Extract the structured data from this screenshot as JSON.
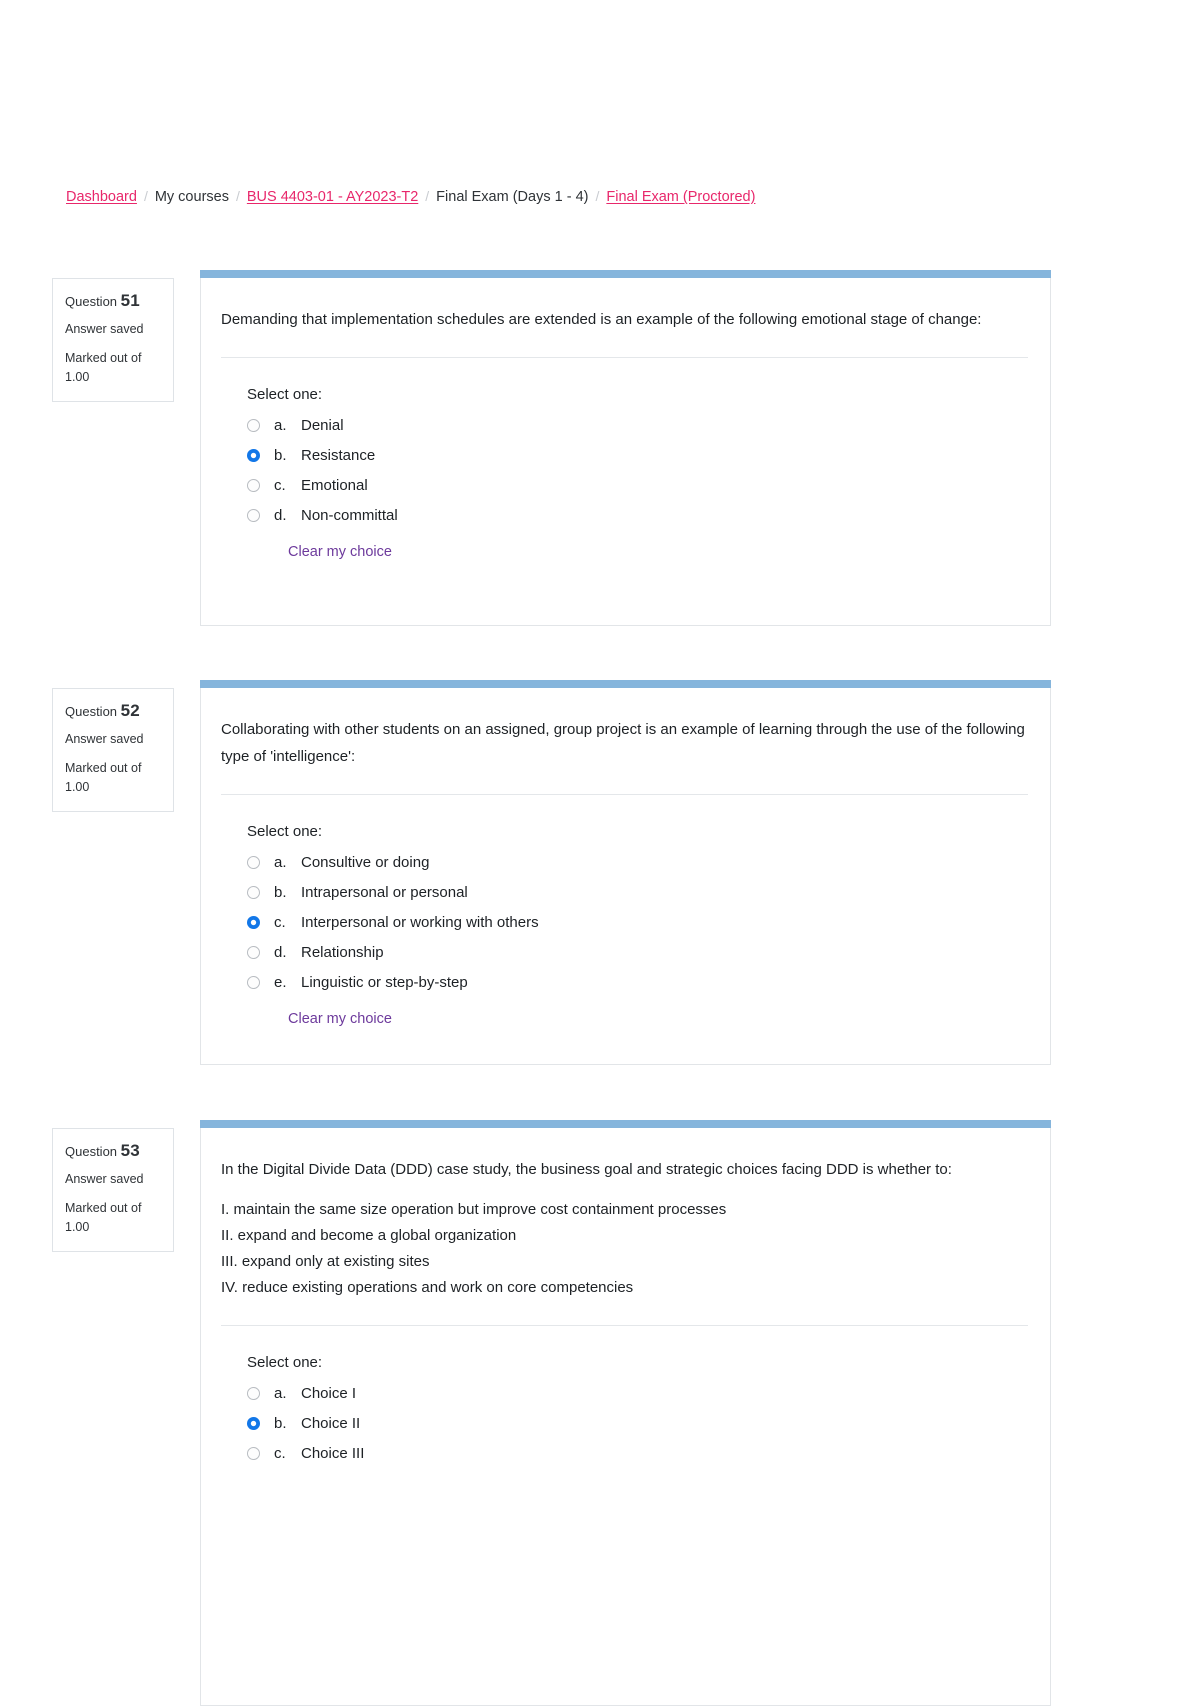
{
  "breadcrumb": {
    "items": [
      {
        "label": "Dashboard",
        "link": true
      },
      {
        "label": "My courses",
        "link": false
      },
      {
        "label": "BUS 4403-01 - AY2023-T2",
        "link": true
      },
      {
        "label": "Final Exam (Days 1 - 4)",
        "link": false
      },
      {
        "label": "Final Exam (Proctored)",
        "link": true
      }
    ],
    "separator": "/"
  },
  "labels": {
    "question_word": "Question",
    "select_one": "Select one:",
    "clear_choice": "Clear my choice",
    "marked_out_of": "Marked out of",
    "answer_saved": "Answer saved"
  },
  "colors": {
    "card_top_bar": "#85b5dc",
    "link": "#e8276b",
    "radio_selected": "#1277e8",
    "clear_choice_link": "#6d3a9c"
  },
  "questions": [
    {
      "number": "51",
      "state": "Answer saved",
      "marked_out_of_label": "Marked out of",
      "marked_out_of_value": "1.00",
      "text": "Demanding that implementation schedules are extended is an example of the following emotional stage of change:",
      "stem_list": [],
      "select_one": "Select one:",
      "options": [
        {
          "letter": "a.",
          "text": "Denial",
          "selected": false
        },
        {
          "letter": "b.",
          "text": "Resistance",
          "selected": true
        },
        {
          "letter": "c.",
          "text": "Emotional",
          "selected": false
        },
        {
          "letter": "d.",
          "text": "Non-committal",
          "selected": false
        }
      ],
      "clear_choice": "Clear my choice"
    },
    {
      "number": "52",
      "state": "Answer saved",
      "marked_out_of_label": "Marked out of",
      "marked_out_of_value": "1.00",
      "text": "Collaborating with other students on an assigned, group project is an example of learning through the use of the following type of 'intelligence':",
      "stem_list": [],
      "select_one": "Select one:",
      "options": [
        {
          "letter": "a.",
          "text": "Consultive or doing",
          "selected": false
        },
        {
          "letter": "b.",
          "text": "Intrapersonal or personal",
          "selected": false
        },
        {
          "letter": "c.",
          "text": "Interpersonal or working with others",
          "selected": true
        },
        {
          "letter": "d.",
          "text": "Relationship",
          "selected": false
        },
        {
          "letter": "e.",
          "text": "Linguistic or step-by-step",
          "selected": false
        }
      ],
      "clear_choice": "Clear my choice"
    },
    {
      "number": "53",
      "state": "Answer saved",
      "marked_out_of_label": "Marked out of",
      "marked_out_of_value": "1.00",
      "text": "In the Digital Divide Data (DDD) case study, the business goal and strategic choices facing DDD is whether to:",
      "stem_list": [
        "I. maintain the same size operation but improve cost containment processes",
        "II. expand and become a global organization",
        "III. expand only at existing sites",
        "IV. reduce existing operations and work on core competencies"
      ],
      "select_one": "Select one:",
      "options": [
        {
          "letter": "a.",
          "text": "Choice I",
          "selected": false
        },
        {
          "letter": "b.",
          "text": "Choice II",
          "selected": true
        },
        {
          "letter": "c.",
          "text": "Choice III",
          "selected": false
        }
      ],
      "clear_choice": ""
    }
  ]
}
